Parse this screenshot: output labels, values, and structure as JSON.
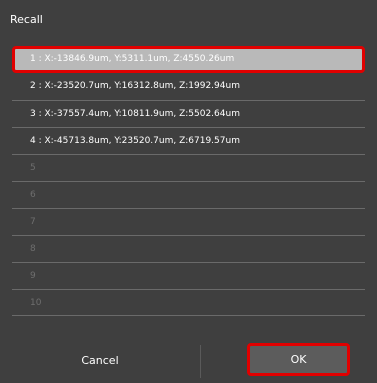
{
  "dialog": {
    "title": "Recall",
    "items": [
      {
        "label": "1 : X:-13846.9um, Y:5311.1um, Z:4550.26um"
      },
      {
        "label": "2 : X:-23520.7um, Y:16312.8um, Z:1992.94um"
      },
      {
        "label": "3 : X:-37557.4um, Y:10811.9um, Z:5502.64um"
      },
      {
        "label": "4 : X:-45713.8um, Y:23520.7um, Z:6719.57um"
      },
      {
        "label": "5"
      },
      {
        "label": "6"
      },
      {
        "label": "7"
      },
      {
        "label": "8"
      },
      {
        "label": "9"
      },
      {
        "label": "10"
      }
    ],
    "selected_index": 1,
    "cancel_label": "Cancel",
    "ok_label": "OK"
  },
  "colors": {
    "background": "#3f3f3f",
    "selected_row": "#b9b9b9",
    "highlight_border": "#e10000",
    "ok_button": "#5c5c5c",
    "empty_slot_text": "#6e6e6e"
  }
}
